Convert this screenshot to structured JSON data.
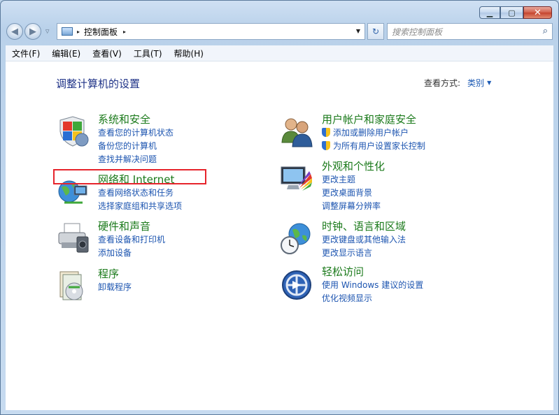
{
  "window": {
    "caption": {
      "minimize": "▁",
      "maximize": "▢",
      "close": "✕"
    }
  },
  "nav": {
    "back": "◀",
    "forward": "▶",
    "history_dropdown": "▽",
    "refresh": "↻"
  },
  "address": {
    "separator": "▸",
    "path": "控制面板",
    "trail": "▸",
    "dropdown": "▼"
  },
  "search": {
    "placeholder": "搜索控制面板",
    "icon": "🔍"
  },
  "menu": [
    "文件(F)",
    "编辑(E)",
    "查看(V)",
    "工具(T)",
    "帮助(H)"
  ],
  "content": {
    "heading": "调整计算机的设置",
    "view_by_label": "查看方式:",
    "view_by_value": "类别",
    "view_by_arrow": "▼"
  },
  "categories": [
    {
      "title": "系统和安全",
      "icon": "shield-icon",
      "links": [
        "查看您的计算机状态",
        "备份您的计算机",
        "查找并解决问题"
      ]
    },
    {
      "title": "网络和 Internet",
      "icon": "network-icon",
      "links": [
        "查看网络状态和任务",
        "选择家庭组和共享选项"
      ]
    },
    {
      "title": "硬件和声音",
      "icon": "printer-icon",
      "links": [
        "查看设备和打印机",
        "添加设备"
      ]
    },
    {
      "title": "程序",
      "icon": "programs-icon",
      "links": [
        "卸载程序"
      ]
    },
    {
      "title": "用户帐户和家庭安全",
      "icon": "users-icon",
      "links": [
        "添加或删除用户帐户",
        "为所有用户设置家长控制"
      ]
    },
    {
      "title": "外观和个性化",
      "icon": "appearance-icon",
      "links": [
        "更改主题",
        "更改桌面背景",
        "调整屏幕分辨率"
      ]
    },
    {
      "title": "时钟、语言和区域",
      "icon": "clock-globe-icon",
      "links": [
        "更改键盘或其他输入法",
        "更改显示语言"
      ]
    },
    {
      "title": "轻松访问",
      "icon": "ease-of-access-icon",
      "links": [
        "使用 Windows 建议的设置",
        "优化视频显示"
      ]
    }
  ],
  "highlight_color": "#e6242c",
  "title_color": "#1b7a1b",
  "link_color": "#1d55b0"
}
